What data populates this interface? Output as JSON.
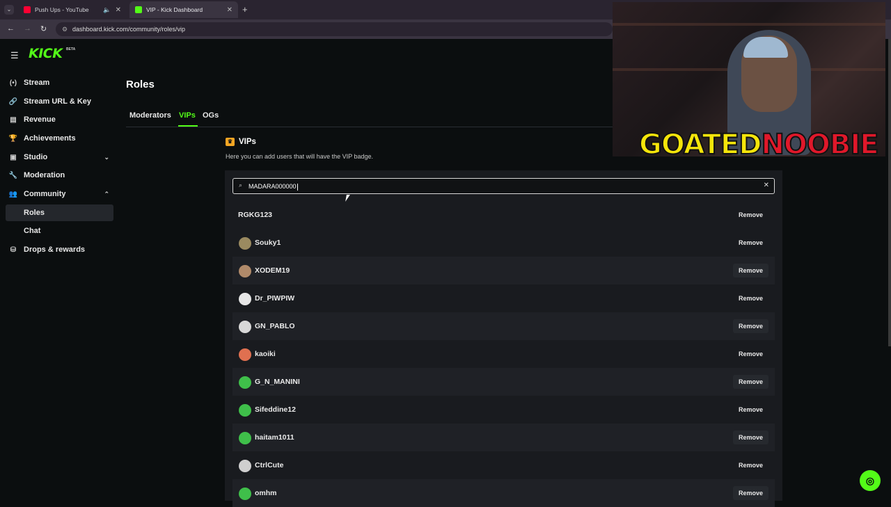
{
  "browser": {
    "tabs": [
      {
        "title": "Push Ups - YouTube",
        "favicon_color": "#ff0033",
        "active": false
      },
      {
        "title": "VIP - Kick Dashboard",
        "favicon_color": "#53fc18",
        "active": true
      }
    ],
    "url": "dashboard.kick.com/community/roles/vip",
    "new_tab_symbol": "+",
    "close_symbol": "✕"
  },
  "brand": {
    "logo_text": "KICK",
    "badge": "BETA",
    "accent": "#53fc18"
  },
  "sidebar": {
    "items": [
      {
        "label": "Stream",
        "icon": "broadcast-icon",
        "glyph": "(•)"
      },
      {
        "label": "Stream URL & Key",
        "icon": "link-icon",
        "glyph": "🔗"
      },
      {
        "label": "Revenue",
        "icon": "chart-icon",
        "glyph": "▤"
      },
      {
        "label": "Achievements",
        "icon": "trophy-icon",
        "glyph": "🏆"
      },
      {
        "label": "Studio",
        "icon": "studio-icon",
        "glyph": "▣",
        "chevron": "⌄"
      },
      {
        "label": "Moderation",
        "icon": "wrench-icon",
        "glyph": "🔧"
      },
      {
        "label": "Community",
        "icon": "community-icon",
        "glyph": "👥",
        "chevron": "⌃"
      },
      {
        "label": "Drops & rewards",
        "icon": "rewards-icon",
        "glyph": "⛁"
      }
    ],
    "community_sub": [
      {
        "label": "Roles",
        "active": true
      },
      {
        "label": "Chat",
        "active": false
      }
    ]
  },
  "main": {
    "title": "Roles",
    "tabs": [
      "Moderators",
      "VIPs",
      "OGs"
    ],
    "active_tab": "VIPs",
    "section_title": "VIPs",
    "section_desc": "Here you can add users that will have the VIP badge.",
    "search_value": "MADARA000000",
    "remove_label": "Remove",
    "users": [
      {
        "name": "RGKG123",
        "avatar": "",
        "alt": false
      },
      {
        "name": "Souky1",
        "avatar": "#9a8a60",
        "alt": false
      },
      {
        "name": "XODEM19",
        "avatar": "#b08a6a",
        "alt": true
      },
      {
        "name": "Dr_PIWPIW",
        "avatar": "#e6e6e6",
        "alt": false
      },
      {
        "name": "GN_PABLO",
        "avatar": "#d8d8d8",
        "alt": true
      },
      {
        "name": "kaoiki",
        "avatar": "#e07050",
        "alt": false
      },
      {
        "name": "G_N_MANINI",
        "avatar": "#3fbf4a",
        "alt": true
      },
      {
        "name": "Sifeddine12",
        "avatar": "#3fbf4a",
        "alt": false
      },
      {
        "name": "haitam1011",
        "avatar": "#3fbf4a",
        "alt": true
      },
      {
        "name": "CtrlCute",
        "avatar": "#cfcfcf",
        "alt": false
      },
      {
        "name": "omhm",
        "avatar": "#3fbf4a",
        "alt": true
      }
    ]
  },
  "overlay": {
    "brand_part1": "GOATED",
    "brand_part2": "NOOBIE"
  }
}
